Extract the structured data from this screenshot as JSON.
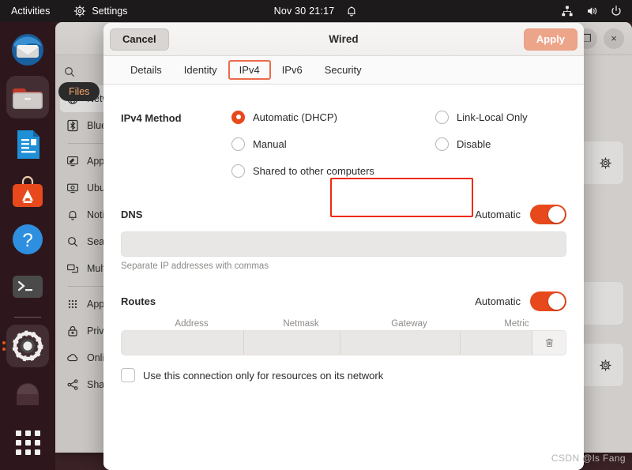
{
  "topbar": {
    "activities": "Activities",
    "app_name": "Settings",
    "app_icon": "gear-icon",
    "datetime": "Nov 30  21:17",
    "notification_icon": "bell-icon",
    "tray": [
      {
        "name": "network-wired-icon"
      },
      {
        "name": "volume-icon"
      },
      {
        "name": "power-icon"
      }
    ]
  },
  "dock": {
    "items": [
      {
        "name": "thunderbird",
        "label": "Thunderbird Mail",
        "active": false
      },
      {
        "name": "files",
        "label": "Files",
        "active": true
      },
      {
        "name": "libreoffice",
        "label": "LibreOffice Writer",
        "active": false
      },
      {
        "name": "ubuntu-software",
        "label": "Ubuntu Software",
        "active": false
      },
      {
        "name": "help",
        "label": "Help",
        "active": false
      },
      {
        "name": "terminal",
        "label": "Terminal",
        "active": false
      },
      {
        "name": "settings",
        "label": "Settings",
        "active": true,
        "running_dots": 2
      },
      {
        "name": "trash",
        "label": "Trash",
        "active": false
      }
    ],
    "show_apps_label": "Show Applications",
    "tooltip": "Files"
  },
  "settings_window": {
    "search_placeholder": "Search",
    "sidebar": [
      {
        "label": "Network",
        "icon": "network-icon",
        "selected": true
      },
      {
        "label": "Bluetooth",
        "icon": "bluetooth-icon",
        "selected": false
      },
      {
        "label": "Appearance",
        "icon": "appearance-icon",
        "selected": false
      },
      {
        "label": "Ubuntu Desktop",
        "icon": "ubuntu-desktop-icon",
        "selected": false
      },
      {
        "label": "Notifications",
        "icon": "bell-icon",
        "selected": false
      },
      {
        "label": "Search",
        "icon": "search-icon",
        "selected": false
      },
      {
        "label": "Multitasking",
        "icon": "multitasking-icon",
        "selected": false
      },
      {
        "label": "Applications",
        "icon": "apps-grid-icon",
        "selected": false
      },
      {
        "label": "Privacy",
        "icon": "lock-icon",
        "selected": false
      },
      {
        "label": "Online Accounts",
        "icon": "cloud-icon",
        "selected": false
      },
      {
        "label": "Sharing",
        "icon": "share-icon",
        "selected": false
      }
    ],
    "panel_controls": [
      {
        "name": "add-wired-button",
        "glyph": "+"
      },
      {
        "name": "wired-settings-gear",
        "glyph": "gear-icon"
      },
      {
        "name": "add-vpn-button",
        "glyph": "+"
      },
      {
        "name": "network-proxy-card",
        "glyph": ""
      },
      {
        "name": "proxy-settings-gear",
        "glyph": "gear-icon"
      }
    ],
    "window_buttons": [
      {
        "name": "maximize-button",
        "glyph": "❐"
      },
      {
        "name": "close-button",
        "glyph": "×"
      }
    ]
  },
  "dialog": {
    "title": "Wired",
    "cancel_label": "Cancel",
    "apply_label": "Apply",
    "tabs": [
      {
        "label": "Details",
        "active": false,
        "highlighted": false
      },
      {
        "label": "Identity",
        "active": false,
        "highlighted": false
      },
      {
        "label": "IPv4",
        "active": true,
        "highlighted": true
      },
      {
        "label": "IPv6",
        "active": false,
        "highlighted": false
      },
      {
        "label": "Security",
        "active": false,
        "highlighted": false
      }
    ],
    "ipv4": {
      "method_label": "IPv4 Method",
      "methods_col1": [
        {
          "label": "Automatic (DHCP)",
          "selected": true
        },
        {
          "label": "Manual",
          "selected": false
        },
        {
          "label": "Shared to other computers",
          "selected": false
        }
      ],
      "methods_col2": [
        {
          "label": "Link-Local Only",
          "selected": false
        },
        {
          "label": "Disable",
          "selected": false
        }
      ],
      "dns": {
        "title": "DNS",
        "automatic_label": "Automatic",
        "automatic_on": true,
        "value": "",
        "hint": "Separate IP addresses with commas"
      },
      "routes": {
        "title": "Routes",
        "automatic_label": "Automatic",
        "automatic_on": true,
        "columns": [
          "Address",
          "Netmask",
          "Gateway",
          "Metric"
        ],
        "rows": [
          {
            "address": "",
            "netmask": "",
            "gateway": "",
            "metric": ""
          }
        ],
        "delete_icon": "trash-icon"
      },
      "restrict_checkbox": {
        "label": "Use this connection only for resources on its network",
        "checked": false
      }
    }
  },
  "watermark": "CSDN @ls Fang",
  "colors": {
    "accent_orange": "#e8491c",
    "apply_peach": "#eda58a",
    "annotation_red": "#ef2a10",
    "tab_highlight": "#ec6b4b",
    "topbar_bg": "#1d1a1b",
    "dock_bg": "#2c171b"
  }
}
